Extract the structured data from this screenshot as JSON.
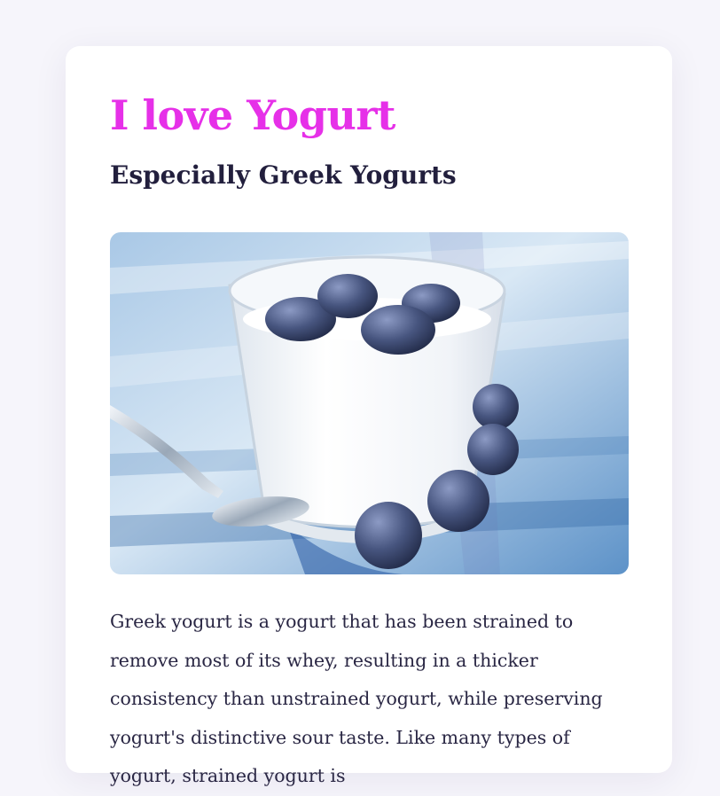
{
  "article": {
    "title": "I love Yogurt",
    "subtitle": "Especially Greek Yogurts",
    "image_subject": "yogurt-with-blueberries",
    "body": "Greek yogurt is a yogurt that has been strained to remove most of its whey, resulting in a thicker consistency than unstrained yogurt, while preserving yogurt's distinctive sour taste. Like many types of yogurt, strained yogurt is"
  },
  "colors": {
    "page_bg": "#f6f5fb",
    "card_bg": "#ffffff",
    "title": "#e630e8",
    "subtitle": "#221f3d",
    "body_text": "#2a2744"
  }
}
